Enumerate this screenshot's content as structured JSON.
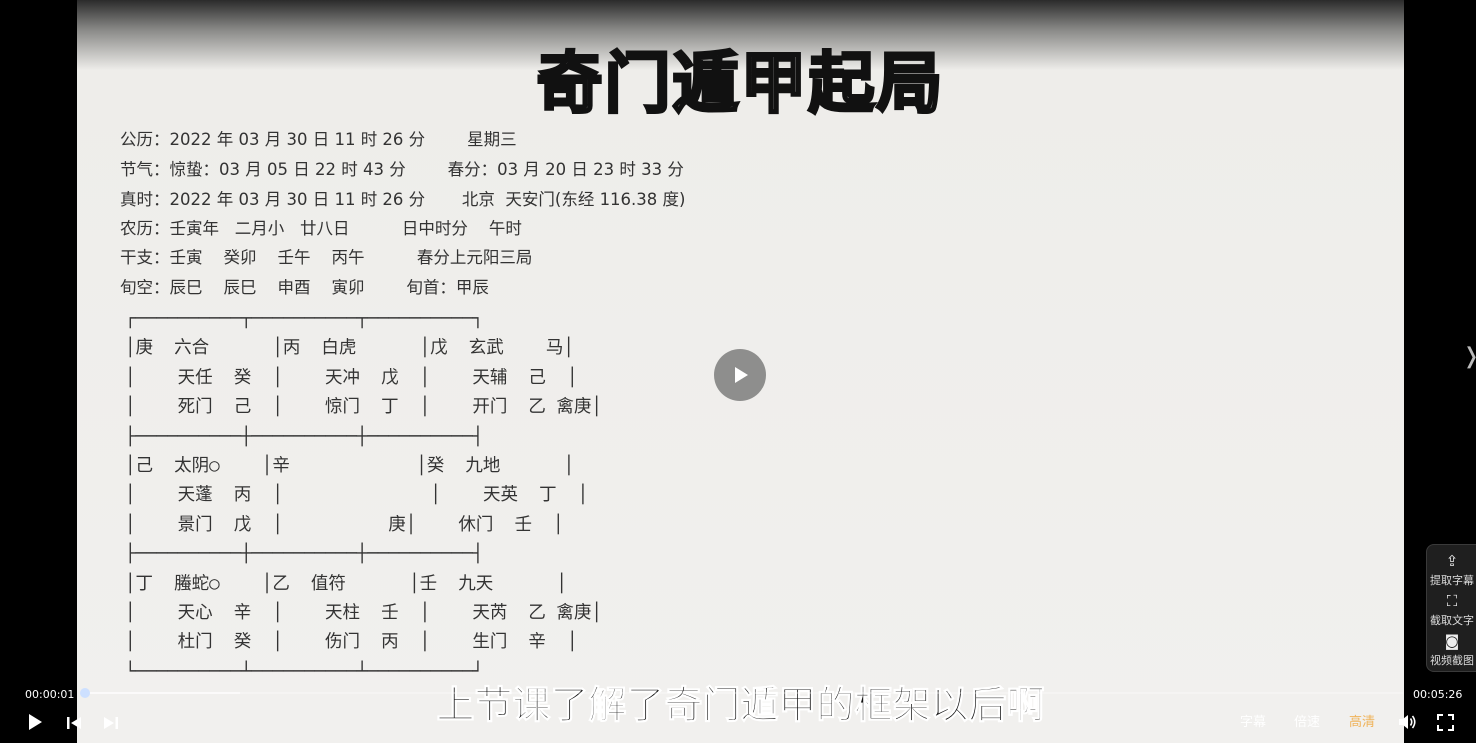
{
  "video": {
    "title_overlay": "奇门遁甲起局",
    "info_lines": [
      "公历：2022 年 03 月 30 日 11 时 26 分        星期三",
      "节气：惊蛰：03 月 05 日 22 时 43 分        春分：03 月 20 日 23 时 33 分",
      "真时：2022 年 03 月 30 日 11 时 26 分       北京  天安门(东经 116.38 度)",
      "农历：壬寅年   二月小   廿八日          日中时分    午时",
      "干支：壬寅    癸卯    壬午    丙午          春分上元阳三局",
      "旬空：辰巳    辰巳    申酉    寅卯        旬首：甲辰"
    ],
    "chart_text": "┌──────────┬──────────┬──────────┐\n│庚  六合      │丙  白虎      │戊  玄武    马│\n│    天任  癸  │    天冲  戊  │    天辅  己  │\n│    死门  己  │    惊门  丁  │    开门  乙 禽庚│\n├──────────┼──────────┼──────────┤\n│己  太阴○    │辛            │癸  九地      │\n│    天蓬  丙  │              │    天英  丁  │\n│    景门  戊  │          庚│    休门  壬  │\n├──────────┼──────────┼──────────┤\n│丁  螣蛇○    │乙  值符      │壬  九天      │\n│    天心  辛  │    天柱  壬  │    天芮  乙 禽庚│\n│    杜门  癸  │    伤门  丙  │    生门  辛  │\n└──────────┴──────────┴──────────┘",
    "subtitle": "上节课了解了奇门遁甲的框架以后啊"
  },
  "side_panel": {
    "extract_subtitle": "提取字幕",
    "capture_text": "截取文字",
    "video_screenshot": "视频截图"
  },
  "controls": {
    "current_time": "00:00:01",
    "total_time": "00:05:26",
    "progress_fraction": 0.003,
    "buffered_fraction": 0.12,
    "subtitle_label": "字幕",
    "speed_label": "倍速",
    "quality_label": "高清",
    "accent_color": "#2f7bff",
    "quality_color": "#f0b35a"
  }
}
